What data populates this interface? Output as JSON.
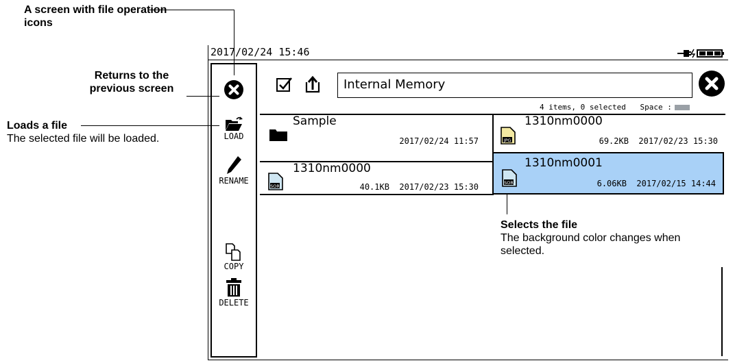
{
  "annotations": {
    "screen_title": "A screen with file operation icons",
    "back_title": "Returns to the previous screen",
    "load_title": "Loads a file",
    "load_desc": "The selected file will be loaded.",
    "select_title": "Selects the file",
    "select_desc": "The background color changes when selected."
  },
  "status": {
    "datetime": "2017/02/24 15:46"
  },
  "sidebar": {
    "load": "LOAD",
    "rename": "RENAME",
    "copy": "COPY",
    "delete": "DELETE"
  },
  "header": {
    "path": "Internal Memory",
    "items_info": "4 items, 0 selected",
    "space_label": "Space :"
  },
  "files": [
    {
      "name": "Sample",
      "size": "",
      "date": "2017/02/24 11:57",
      "icon": "folder-icon"
    },
    {
      "name": "1310nm0000",
      "size": "69.2KB",
      "date": "2017/02/23 15:30",
      "icon": "jpg-file-icon",
      "badge": "JPG"
    },
    {
      "name": "1310nm0000",
      "size": "40.1KB",
      "date": "2017/02/23 15:30",
      "icon": "sor-file-icon",
      "badge": "SOR"
    },
    {
      "name": "1310nm0001",
      "size": "6.06KB",
      "date": "2017/02/15 14:44",
      "icon": "sor-file-icon",
      "badge": "SOR"
    }
  ],
  "colors": {
    "selected_bg": "#a9d1f7",
    "jpg_icon": "#f3e9a2",
    "sor_icon": "#cfe6f2"
  }
}
